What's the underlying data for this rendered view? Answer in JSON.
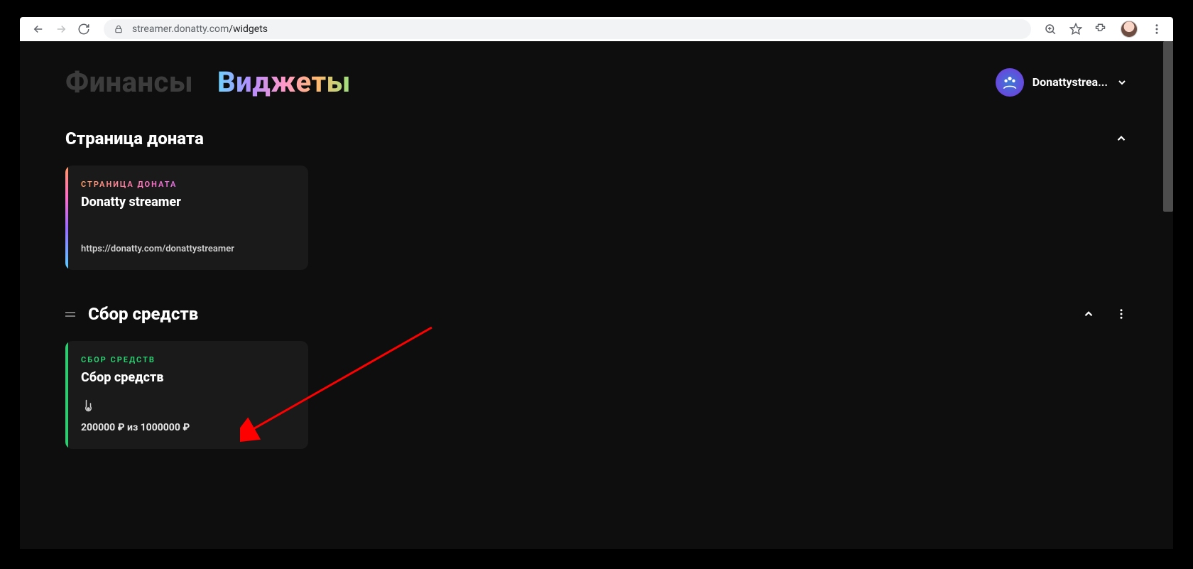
{
  "browser": {
    "url_host": "streamer.donatty.com",
    "url_path": "/widgets"
  },
  "header": {
    "tab_finance": "Финансы",
    "tab_widgets": "Виджеты",
    "user_name": "Donattystrea..."
  },
  "sections": {
    "donate_page": {
      "title": "Страница доната",
      "card": {
        "kicker": "СТРАНИЦА ДОНАТА",
        "title": "Donatty streamer",
        "url": "https://donatty.com/donattystreamer"
      }
    },
    "fundraising": {
      "title": "Сбор средств",
      "card": {
        "kicker": "СБОР СРЕДСТВ",
        "title": "Сбор средств",
        "progress": "200000 ₽ из 1000000 ₽"
      }
    }
  }
}
